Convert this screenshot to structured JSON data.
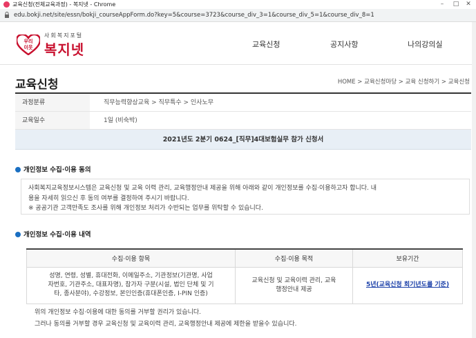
{
  "window": {
    "title": "교육신청(전체교육과정) - 복지넷 - Chrome"
  },
  "address": {
    "url": "edu.bokji.net/site/essn/bokji_courseAppForm.do?key=5&course=3723&course_div_3=1&course_div_5=1&course_div_8=1"
  },
  "header": {
    "logo_tagline": "사회복지포털",
    "logo_name": "복지넷",
    "logo_heart_text": "우리이웃",
    "nav": [
      "교육신청",
      "공지사항",
      "나의강의실"
    ]
  },
  "page": {
    "title": "교육신청",
    "breadcrumb": "HOME > 교육신청마당 > 교육 신청하기 > 교육신청"
  },
  "info": {
    "rows": [
      {
        "label": "과정분류",
        "value": "직무능력향상교육 > 직무특수 > 인사노무"
      },
      {
        "label": "교육일수",
        "value": "1일 (비숙박)"
      }
    ],
    "form_title": "2021년도 2분기 0624_[직무]4대보험실무 참가 신청서"
  },
  "consent": {
    "heading": "개인정보 수집·이용 동의",
    "line1": "사회복지교육정보시스템은 교육신청 및 교육 이력 관리, 교육행정안내 제공을 위해 아래와 같이 개인정보를 수집·이용하고자 합니다. 내",
    "line2": "용을 자세히 읽으신 후 동의 여부를 결정하여 주시기 바랍니다.",
    "line3": "※ 공공기관 고객만족도 조사를 위해 개인정보 처리가 수반되는 업무를 위탁할 수 있습니다."
  },
  "details": {
    "heading": "개인정보 수집·이용 내역",
    "columns": [
      "수집·이용 항목",
      "수집·이용 목적",
      "보유기간"
    ],
    "items_line1": "성명, 연령, 성별, 휴대전화, 이메일주소, 기관정보(기관명, 사업",
    "items_line2": "자번호, 기관주소, 대표자명), 참가자 구분(시설, 법인 단체 및 기",
    "items_line3": "타, 종사분야), 수강정보, 본인인증(휴대폰인증, I-PIN 인증)",
    "purpose_line1": "교육신청 및 교육이력 관리, 교육",
    "purpose_line2": "행정안내 제공",
    "retention": "5년(교육신청 회기년도를 기준)",
    "note1": "위의 개인정보 수집·이용에 대한 동의를 거부할 권리가 있습니다.",
    "note2": "그러나 동의를 거부할 경우 교육신청 및 교육이력 관리, 교육행정안내 제공에 제한을 받을수 있습니다."
  },
  "colors": {
    "brand": "#c8102e",
    "accent": "#1a6fc2",
    "link": "#1a3fa8"
  }
}
